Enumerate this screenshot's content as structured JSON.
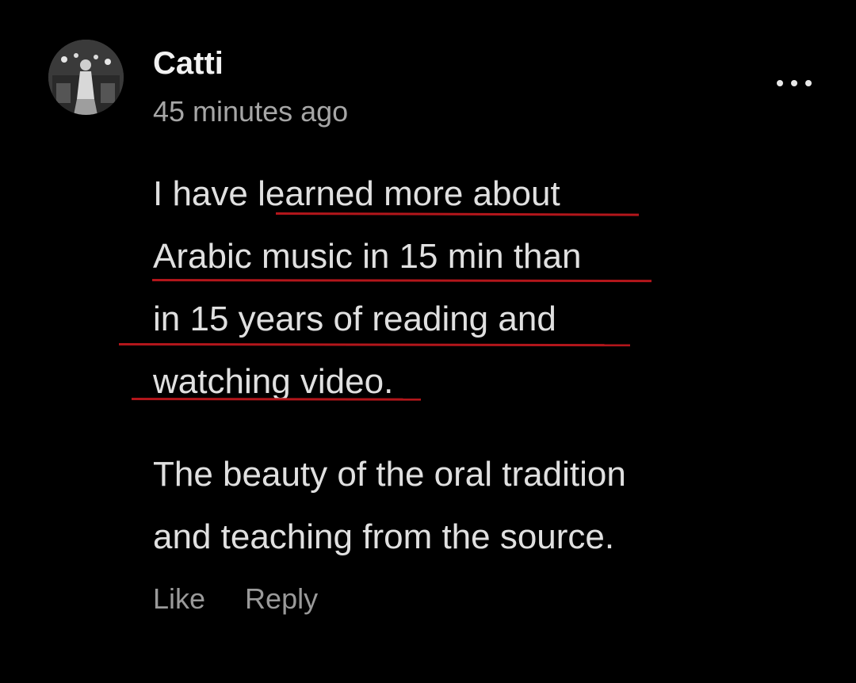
{
  "comment": {
    "author": "Catti",
    "timestamp": "45 minutes ago",
    "paragraph1_lines": [
      "I have learned more about",
      "Arabic music in 15 min than",
      "in 15 years of reading and",
      "watching video."
    ],
    "paragraph2_lines": [
      "The beauty of the oral tradition",
      "and teaching from the source."
    ],
    "actions": {
      "like_label": "Like",
      "reply_label": "Reply"
    }
  },
  "icons": {
    "more_menu": "more-horizontal-icon",
    "avatar": "avatar-photo"
  },
  "colors": {
    "background": "#000000",
    "author_text": "#f2f2f2",
    "body_text": "#e0e0e0",
    "muted_text": "#a6a6a6",
    "underline_annotation": "#b3161b"
  }
}
